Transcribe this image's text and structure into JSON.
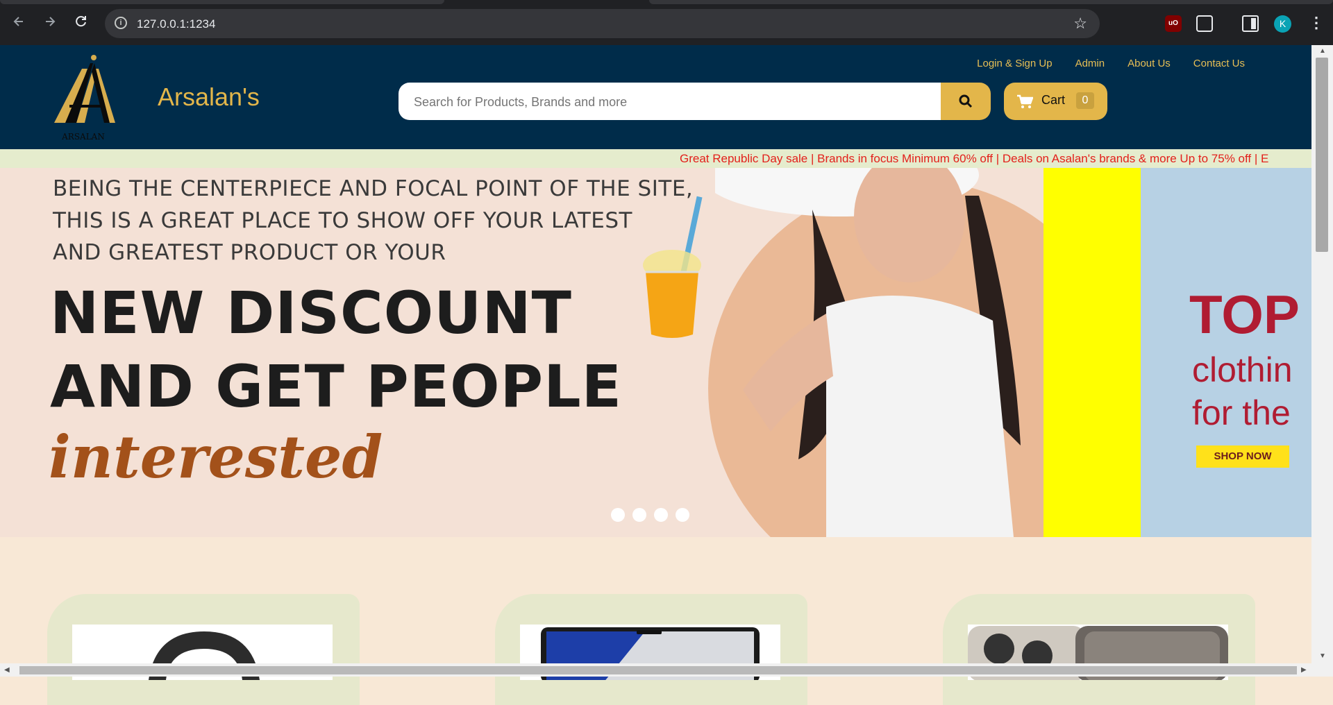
{
  "browser": {
    "url": "127.0.0.1:1234",
    "back_icon": "arrow-left-icon",
    "forward_icon": "arrow-right-icon",
    "reload_icon": "reload-icon",
    "avatar_initial": "K",
    "extension_label": "uO"
  },
  "header": {
    "brand": "Arsalan's",
    "logo_text": "ARSALAN",
    "links": [
      "Login & Sign Up",
      "Admin",
      "About Us",
      "Contact Us"
    ],
    "search_placeholder": "Search for Products, Brands and more",
    "cart_label": "Cart",
    "cart_count": "0"
  },
  "ticker": {
    "text": "Great Republic Day sale | Brands in focus     Minimum 60% off | Deals on Asalan's brands & more     Up to 75% off | E"
  },
  "banner": {
    "lines": [
      "BEING THE CENTERPIECE AND FOCAL POINT OF THE SITE,",
      "THIS IS A GREAT PLACE TO SHOW OFF YOUR LATEST",
      "AND GREATEST PRODUCT OR YOUR"
    ],
    "big_lines": [
      "NEW DISCOUNT",
      "AND GET PEOPLE"
    ],
    "script": "interested",
    "second_slide": {
      "title": "TOP",
      "sub1": "clothin",
      "sub2": "for the",
      "button": "SHOP NOW"
    },
    "slide_count": 4
  },
  "colors": {
    "header_bg": "#002c4a",
    "accent": "#e3b64a",
    "ticker_text": "#e3201b",
    "page_bg": "#f8e8d6"
  }
}
